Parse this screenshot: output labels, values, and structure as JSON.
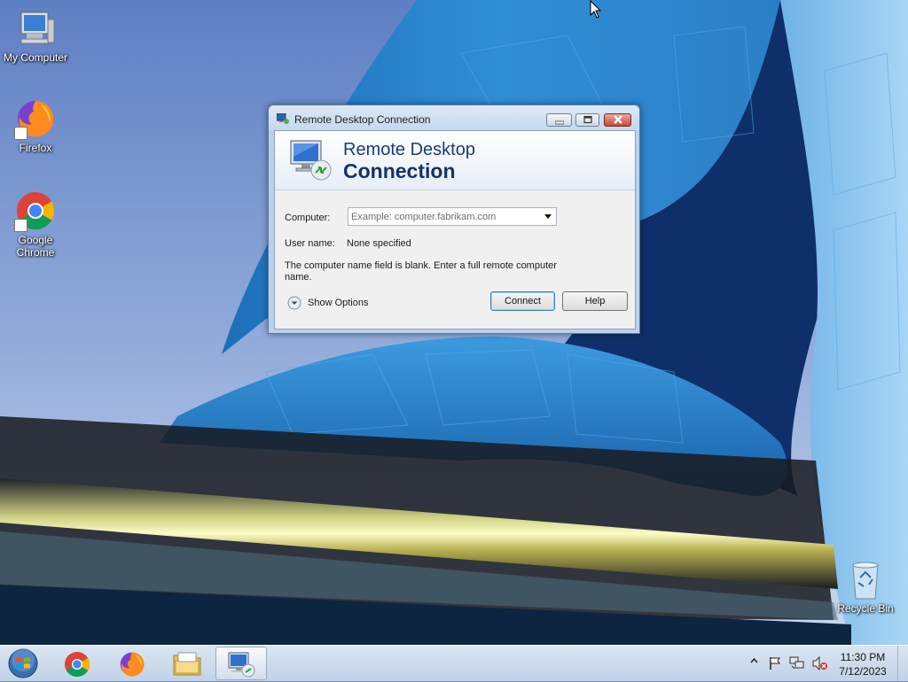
{
  "desktop": {
    "icons": [
      {
        "label": "My Computer",
        "icon": "computer-icon"
      },
      {
        "label": "Firefox",
        "icon": "firefox-icon"
      },
      {
        "label": "Google Chrome",
        "icon": "chrome-icon"
      },
      {
        "label": "Recycle Bin",
        "icon": "recycle-bin-icon"
      }
    ]
  },
  "dialog": {
    "title": "Remote Desktop Connection",
    "banner_line1": "Remote Desktop",
    "banner_line2": "Connection",
    "computer_label": "Computer:",
    "computer_value": "",
    "computer_placeholder": "Example: computer.fabrikam.com",
    "user_label": "User name:",
    "user_value": "None specified",
    "hint": "The computer name field is blank. Enter a full remote computer name.",
    "show_options_label": "Show Options",
    "connect_label": "Connect",
    "help_label": "Help"
  },
  "taskbar": {
    "apps": [
      "chrome-icon",
      "firefox-icon",
      "file-explorer-icon",
      "remote-desktop-icon"
    ],
    "active_app": "remote-desktop-icon",
    "tray_icons": [
      "show-hidden-icons-chevron",
      "action-center-flag-icon",
      "network-icon",
      "volume-muted-icon"
    ],
    "time": "11:30 PM",
    "date": "7/12/2023"
  },
  "colors": {
    "banner_text": "#1c3a78",
    "taskbar": "#c1d2e7",
    "window_frame": "#b9d1ea",
    "close_button": "#c74a35"
  }
}
